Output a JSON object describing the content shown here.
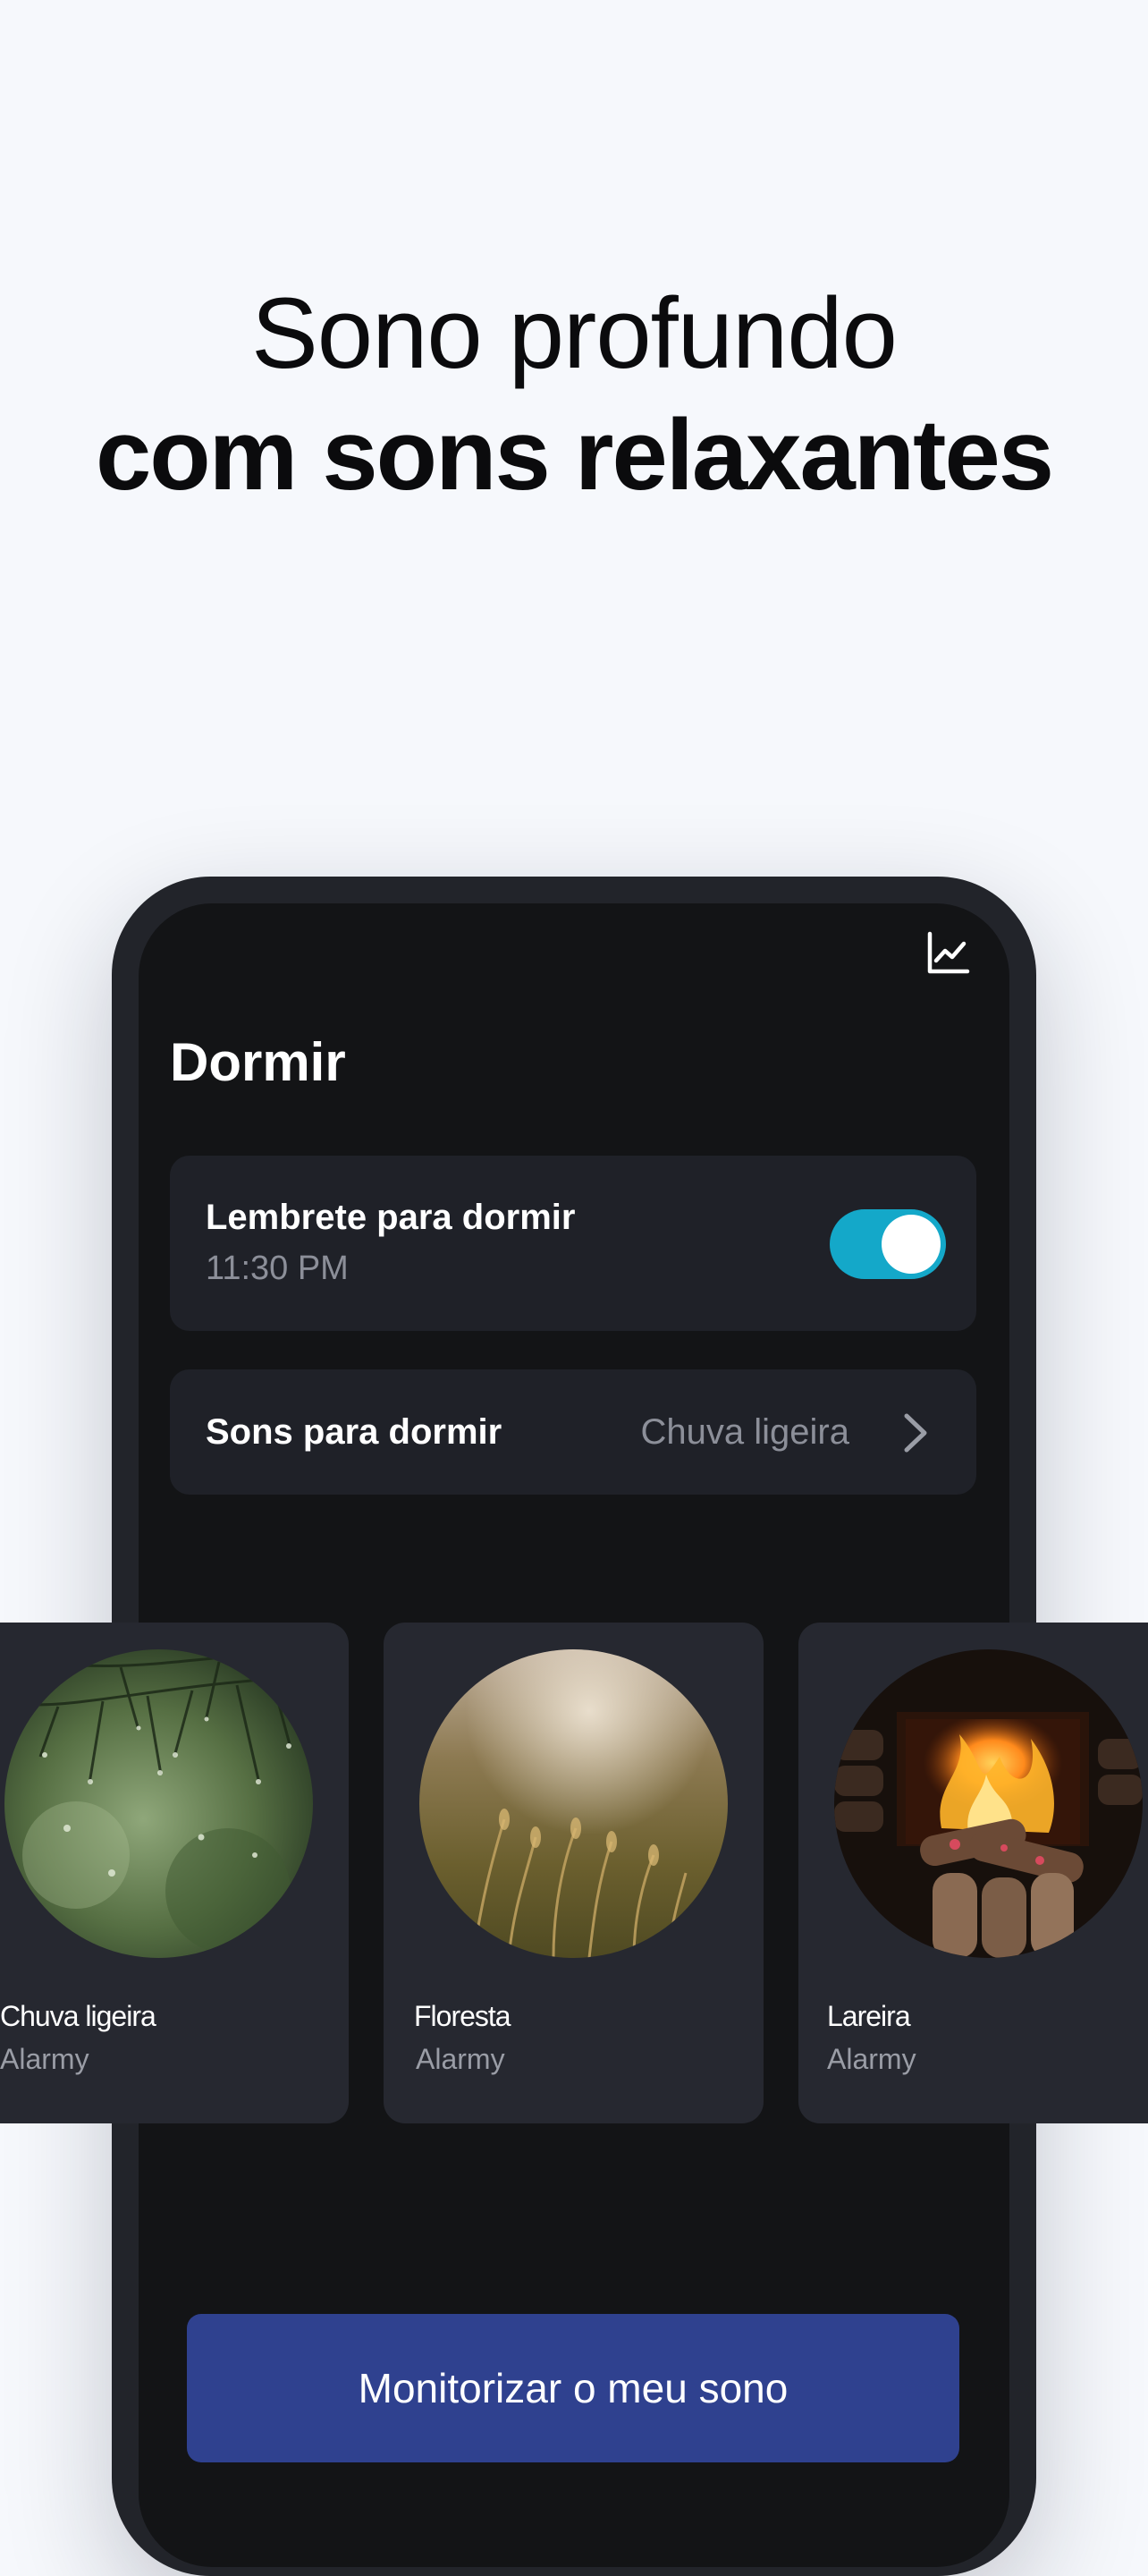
{
  "headline": {
    "line1": "Sono profundo",
    "line2": "com sons relaxantes"
  },
  "screen": {
    "title": "Dormir",
    "stats_icon": "line-chart-icon"
  },
  "reminder": {
    "title": "Lembrete para dormir",
    "time": "11:30 PM",
    "enabled": true
  },
  "sleep_sounds": {
    "label": "Sons para dormir",
    "value": "Chuva ligeira",
    "chevron_icon": "chevron-right-icon"
  },
  "sound_tiles": [
    {
      "name": "Chuva ligeira",
      "source": "Alarmy"
    },
    {
      "name": "Floresta",
      "source": "Alarmy"
    },
    {
      "name": "Lareira",
      "source": "Alarmy"
    }
  ],
  "cta": {
    "label": "Monitorizar o meu sono"
  },
  "colors": {
    "background": "#f6f8fc",
    "phone_screen": "#131416",
    "card": "#1f2128",
    "toggle_on": "#14a8c9",
    "cta": "#2f418f"
  }
}
